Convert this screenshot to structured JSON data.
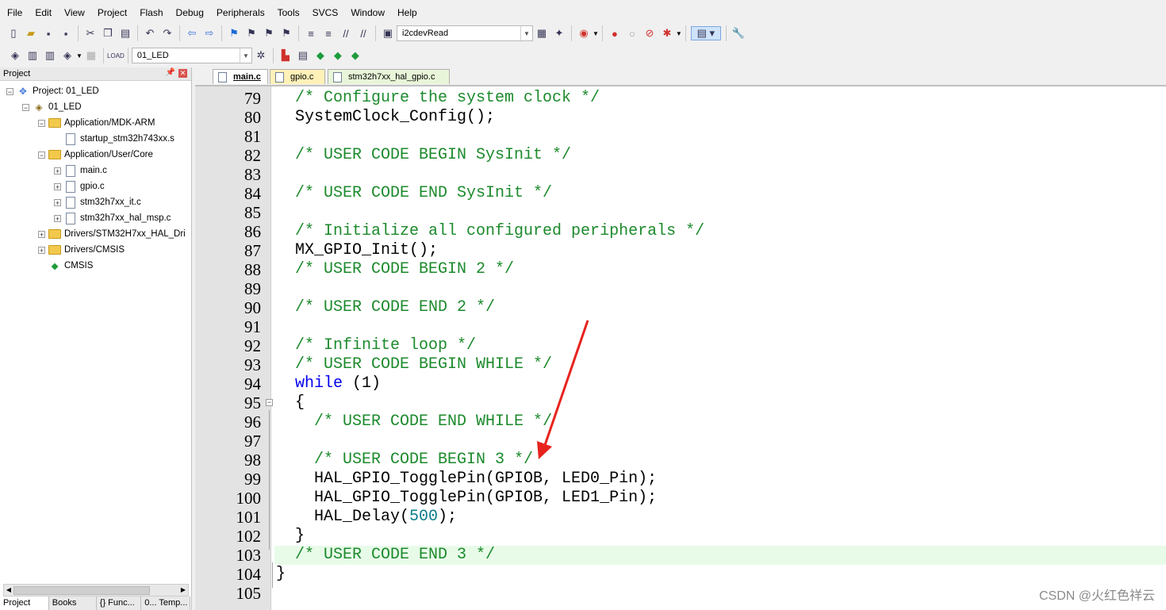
{
  "menu": [
    "File",
    "Edit",
    "View",
    "Project",
    "Flash",
    "Debug",
    "Peripherals",
    "Tools",
    "SVCS",
    "Window",
    "Help"
  ],
  "toolbar": {
    "find_combo": "i2cdevRead",
    "target_combo": "01_LED"
  },
  "project_panel": {
    "title": "Project",
    "tree": [
      {
        "label": "Project: 01_LED",
        "indent": 0,
        "expander": "⊟",
        "icon": "project"
      },
      {
        "label": "01_LED",
        "indent": 1,
        "expander": "⊟",
        "icon": "target"
      },
      {
        "label": "Application/MDK-ARM",
        "indent": 2,
        "expander": "⊟",
        "icon": "folder"
      },
      {
        "label": "startup_stm32h743xx.s",
        "indent": 3,
        "expander": "",
        "icon": "file"
      },
      {
        "label": "Application/User/Core",
        "indent": 2,
        "expander": "⊟",
        "icon": "folder"
      },
      {
        "label": "main.c",
        "indent": 3,
        "expander": "⊞",
        "icon": "file"
      },
      {
        "label": "gpio.c",
        "indent": 3,
        "expander": "⊞",
        "icon": "file"
      },
      {
        "label": "stm32h7xx_it.c",
        "indent": 3,
        "expander": "⊞",
        "icon": "file"
      },
      {
        "label": "stm32h7xx_hal_msp.c",
        "indent": 3,
        "expander": "⊞",
        "icon": "file"
      },
      {
        "label": "Drivers/STM32H7xx_HAL_Dri",
        "indent": 2,
        "expander": "⊞",
        "icon": "folder"
      },
      {
        "label": "Drivers/CMSIS",
        "indent": 2,
        "expander": "⊞",
        "icon": "folder"
      },
      {
        "label": "CMSIS",
        "indent": 2,
        "expander": "",
        "icon": "cmsis"
      }
    ],
    "bottom_tabs": [
      "Project",
      "Books",
      "{} Func...",
      "0... Temp..."
    ]
  },
  "editor_tabs": [
    "main.c",
    "gpio.c",
    "stm32h7xx_hal_gpio.c"
  ],
  "code_lines": [
    {
      "n": "79",
      "html": "<span class=\"c\">/* Configure the system clock */</span>",
      "indent": 1
    },
    {
      "n": "80",
      "html": "SystemClock_Config();",
      "indent": 1
    },
    {
      "n": "81",
      "html": "",
      "indent": 1
    },
    {
      "n": "82",
      "html": "<span class=\"c\">/* USER CODE BEGIN SysInit */</span>",
      "indent": 1
    },
    {
      "n": "83",
      "html": "",
      "indent": 1
    },
    {
      "n": "84",
      "html": "<span class=\"c\">/* USER CODE END SysInit */</span>",
      "indent": 1
    },
    {
      "n": "85",
      "html": "",
      "indent": 1
    },
    {
      "n": "86",
      "html": "<span class=\"c\">/* Initialize all configured peripherals */</span>",
      "indent": 1
    },
    {
      "n": "87",
      "html": "MX_GPIO_Init();",
      "indent": 1
    },
    {
      "n": "88",
      "html": "<span class=\"c\">/* USER CODE BEGIN 2 */</span>",
      "indent": 1
    },
    {
      "n": "89",
      "html": "",
      "indent": 1
    },
    {
      "n": "90",
      "html": "<span class=\"c\">/* USER CODE END 2 */</span>",
      "indent": 1
    },
    {
      "n": "91",
      "html": "",
      "indent": 1
    },
    {
      "n": "92",
      "html": "<span class=\"c\">/* Infinite loop */</span>",
      "indent": 1
    },
    {
      "n": "93",
      "html": "<span class=\"c\">/* USER CODE BEGIN WHILE */</span>",
      "indent": 1
    },
    {
      "n": "94",
      "html": "<span class=\"kw\">while</span> (1)",
      "indent": 1
    },
    {
      "n": "95",
      "html": "{",
      "indent": 1
    },
    {
      "n": "96",
      "html": "  <span class=\"c\">/* USER CODE END WHILE */</span>",
      "indent": 1
    },
    {
      "n": "97",
      "html": "",
      "indent": 1
    },
    {
      "n": "98",
      "html": "  <span class=\"c\">/* USER CODE BEGIN 3 */</span>",
      "indent": 1
    },
    {
      "n": "99",
      "html": "  HAL_GPIO_TogglePin(GPIOB, LED0_Pin);",
      "indent": 1
    },
    {
      "n": "100",
      "html": "  HAL_GPIO_TogglePin(GPIOB, LED1_Pin);",
      "indent": 1
    },
    {
      "n": "101",
      "html": "  HAL_Delay(<span class=\"num\">500</span>);",
      "indent": 1
    },
    {
      "n": "102",
      "html": "}",
      "indent": 1
    },
    {
      "n": "103",
      "html": "<span class=\"c\">/* USER CODE END 3 */</span>",
      "indent": 1
    },
    {
      "n": "104",
      "html": "}",
      "indent": 0
    },
    {
      "n": "105",
      "html": "",
      "indent": 0
    }
  ],
  "highlighted_line": "103",
  "watermark": "CSDN @火红色祥云",
  "colors": {
    "comment": "#1c8a2c",
    "keyword": "#0000ee",
    "number": "#0b7c8c",
    "annotation_arrow": "#e8231e"
  }
}
